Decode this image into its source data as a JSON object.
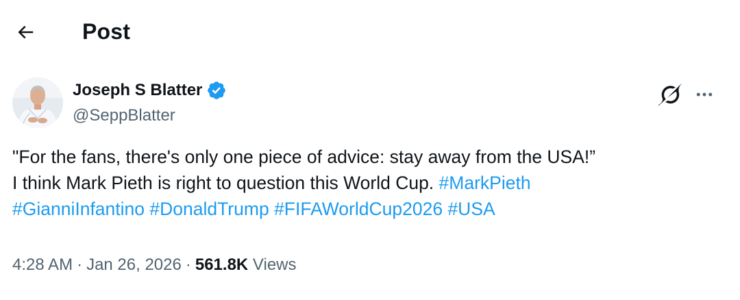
{
  "header": {
    "back_icon": "arrow-left-icon",
    "title": "Post"
  },
  "author": {
    "name": "Joseph S Blatter",
    "handle": "@SeppBlatter",
    "verified_icon": "verified-badge-icon",
    "verified_color": "#1d9bf0"
  },
  "actions": {
    "grok_icon": "grok-icon",
    "more_icon": "more-horizontal-icon"
  },
  "tweet": {
    "line1": "\"For the fans, there's only one piece of advice: stay away from the USA!”",
    "line2_text": "I think Mark Pieth is right to question this World Cup. ",
    "hashtags": [
      "#MarkPieth",
      "#GianniInfantino",
      "#DonaldTrump",
      "#FIFAWorldCup2026",
      "#USA"
    ]
  },
  "meta": {
    "time": "4:28 AM",
    "separator": "·",
    "date": "Jan 26, 2026",
    "views_count": "561.8K",
    "views_label": "Views"
  },
  "colors": {
    "text": "#0f1419",
    "secondary": "#536471",
    "accent": "#1d9bf0"
  }
}
